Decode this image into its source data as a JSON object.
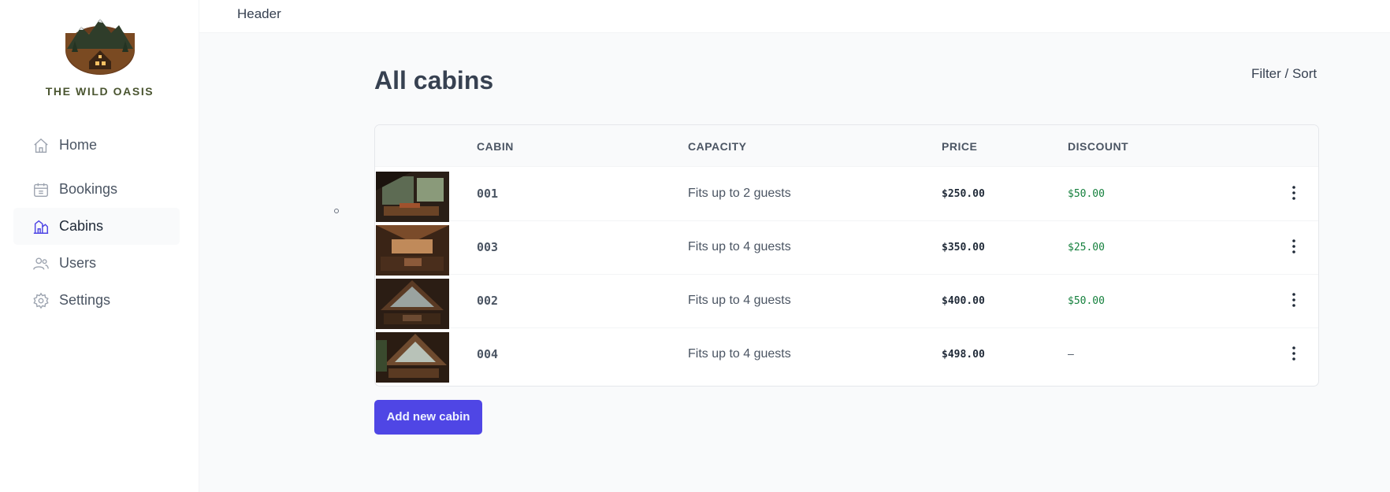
{
  "brand": {
    "name": "THE WILD OASIS",
    "logo_icon": "mountain-cabin-logo"
  },
  "sidebar": {
    "items": [
      {
        "label": "Home",
        "icon": "home-icon",
        "active": false
      },
      {
        "label": "Bookings",
        "icon": "calendar-icon",
        "active": false
      },
      {
        "label": "Cabins",
        "icon": "cabin-icon",
        "active": true
      },
      {
        "label": "Users",
        "icon": "users-icon",
        "active": false
      },
      {
        "label": "Settings",
        "icon": "gear-icon",
        "active": false
      }
    ]
  },
  "header": {
    "label": "Header"
  },
  "main": {
    "title": "All cabins",
    "filter_sort_label": "Filter / Sort",
    "add_button_label": "Add new cabin"
  },
  "table": {
    "columns": [
      "CABIN",
      "CAPACITY",
      "PRICE",
      "DISCOUNT"
    ],
    "rows": [
      {
        "cabin": "001",
        "capacity": "Fits up to 2 guests",
        "price": "$250.00",
        "discount": "$50.00"
      },
      {
        "cabin": "003",
        "capacity": "Fits up to 4 guests",
        "price": "$350.00",
        "discount": "$25.00"
      },
      {
        "cabin": "002",
        "capacity": "Fits up to 4 guests",
        "price": "$400.00",
        "discount": "$50.00"
      },
      {
        "cabin": "004",
        "capacity": "Fits up to 4 guests",
        "price": "$498.00",
        "discount": "—"
      }
    ]
  },
  "colors": {
    "accent": "#4f46e5",
    "discount_green": "#15803d",
    "sidebar_bg": "#ffffff",
    "page_bg": "#f9fafb"
  }
}
